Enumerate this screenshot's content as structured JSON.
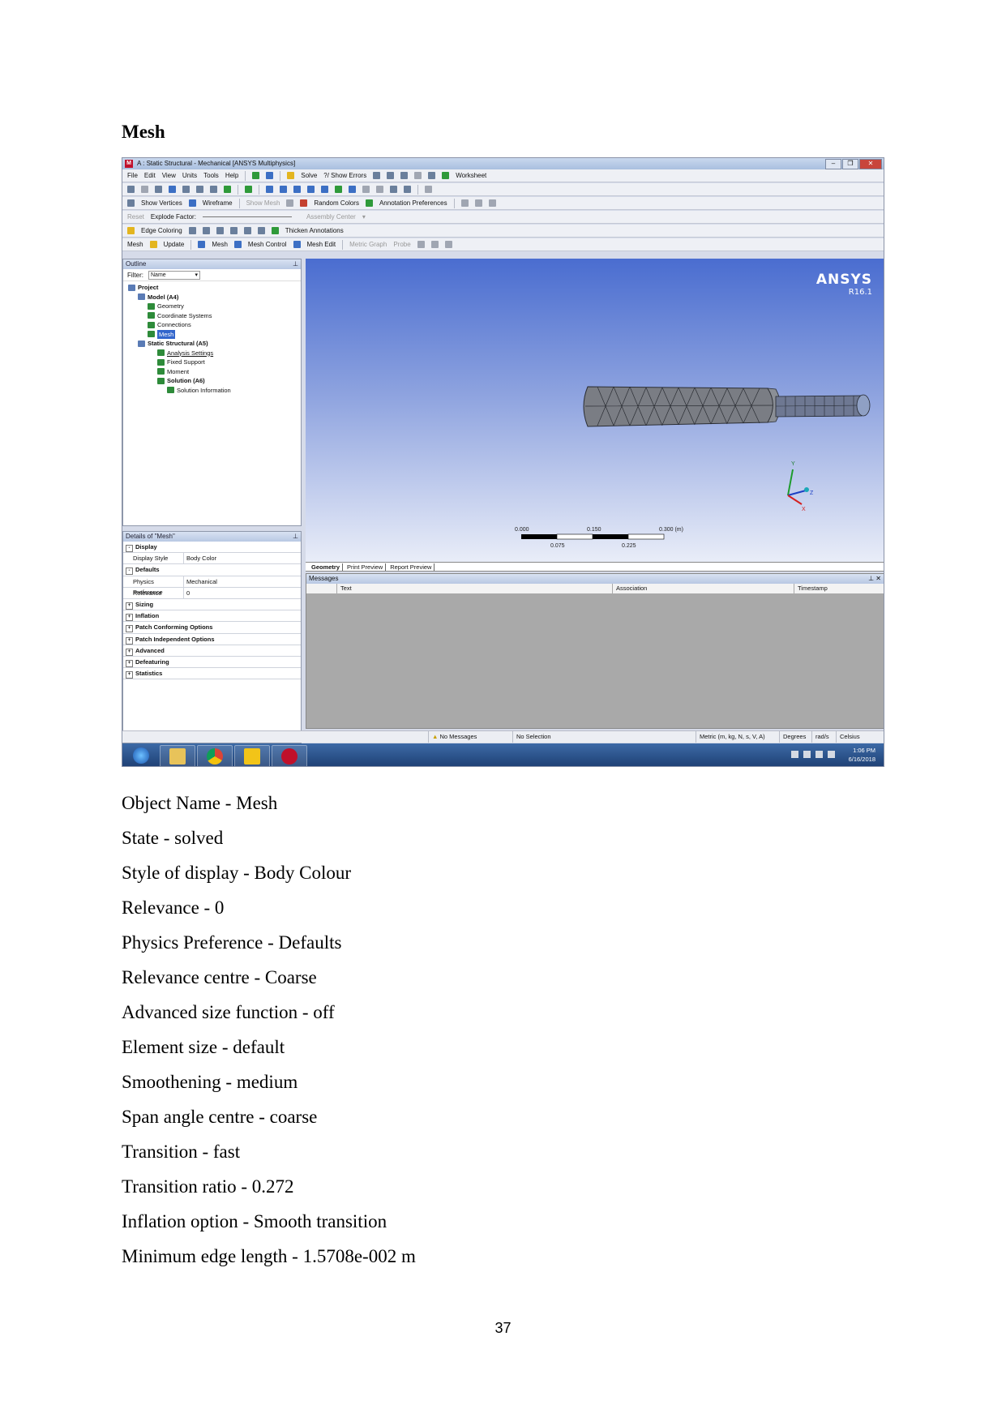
{
  "heading": "Mesh",
  "screenshot": {
    "window_title": "A : Static Structural - Mechanical [ANSYS Multiphysics]",
    "menu": [
      "File",
      "Edit",
      "View",
      "Units",
      "Tools",
      "Help"
    ],
    "toolbar1": {
      "solve": "Solve",
      "show_errors": "?/ Show Errors",
      "worksheet": "Worksheet"
    },
    "toolbar3": {
      "show_vertices": "Show Vertices",
      "wireframe": "Wireframe",
      "show_mesh": "Show Mesh",
      "random_colors": "Random Colors",
      "annotation_preferences": "Annotation Preferences"
    },
    "toolbar4": {
      "reset": "Reset",
      "explode_factor": "Explode Factor:",
      "assembly_center": "Assembly Center"
    },
    "toolbar5": {
      "edge_coloring": "Edge Coloring",
      "thicken_annotations": "Thicken Annotations"
    },
    "toolbar6": {
      "mesh": "Mesh",
      "update": "Update",
      "mesh_dd": "Mesh",
      "mesh_control": "Mesh Control",
      "mesh_edit": "Mesh Edit",
      "metric_graph": "Metric Graph",
      "probe": "Probe"
    },
    "outline": {
      "title": "Outline",
      "filter_label": "Filter:",
      "filter_value": "Name",
      "tree": [
        {
          "label": "Project",
          "indent": 0,
          "bold": true
        },
        {
          "label": "Model (A4)",
          "indent": 1,
          "bold": true
        },
        {
          "label": "Geometry",
          "indent": 2
        },
        {
          "label": "Coordinate Systems",
          "indent": 2
        },
        {
          "label": "Connections",
          "indent": 2
        },
        {
          "label": "Mesh",
          "indent": 2,
          "selected": true
        },
        {
          "label": "Static Structural (A5)",
          "indent": 1,
          "bold": true
        },
        {
          "label": "Analysis Settings",
          "indent": 3,
          "underline": true
        },
        {
          "label": "Fixed Support",
          "indent": 3
        },
        {
          "label": "Moment",
          "indent": 3
        },
        {
          "label": "Solution (A6)",
          "indent": 3,
          "bold": true
        },
        {
          "label": "Solution Information",
          "indent": 4
        }
      ]
    },
    "details": {
      "title": "Details of \"Mesh\"",
      "rows": [
        {
          "type": "group",
          "label": "Display",
          "sign": "-"
        },
        {
          "type": "row",
          "label": "Display Style",
          "value": "Body Color"
        },
        {
          "type": "group",
          "label": "Defaults",
          "sign": "-"
        },
        {
          "type": "row",
          "label": "Physics Preference",
          "value": "Mechanical"
        },
        {
          "type": "row",
          "label": "Relevance",
          "value": "0"
        },
        {
          "type": "group",
          "label": "Sizing",
          "sign": "+"
        },
        {
          "type": "group",
          "label": "Inflation",
          "sign": "+"
        },
        {
          "type": "group",
          "label": "Patch Conforming Options",
          "sign": "+"
        },
        {
          "type": "group",
          "label": "Patch Independent Options",
          "sign": "+"
        },
        {
          "type": "group",
          "label": "Advanced",
          "sign": "+"
        },
        {
          "type": "group",
          "label": "Defeaturing",
          "sign": "+"
        },
        {
          "type": "group",
          "label": "Statistics",
          "sign": "+"
        }
      ]
    },
    "brand": {
      "name": "ANSYS",
      "version": "R16.1"
    },
    "scale_bar": {
      "top_labels": [
        "0.000",
        "0.150",
        "0.300 (m)"
      ],
      "bottom_labels": [
        "0.075",
        "0.225"
      ]
    },
    "triad": {
      "y": "Y",
      "z": "Z",
      "x": "X"
    },
    "tabs": [
      "Geometry",
      "Print Preview",
      "Report Preview"
    ],
    "messages": {
      "title": "Messages",
      "columns": [
        "Text",
        "Association",
        "Timestamp"
      ]
    },
    "status": {
      "messages": "No Messages",
      "selection": "No Selection",
      "units": "Metric (m, kg, N, s, V, A)",
      "angle": "Degrees",
      "rate": "rad/s",
      "temp": "Celsius"
    },
    "taskbar": {
      "time": "1:06 PM",
      "date": "6/16/2018"
    }
  },
  "properties": [
    "Object Name - Mesh",
    "State - solved",
    "Style of display - Body Colour",
    "Relevance - 0",
    "Physics Preference - Defaults",
    "Relevance centre - Coarse",
    "Advanced size function - off",
    "Element size - default",
    "Smoothening - medium",
    "Span angle centre - coarse",
    "Transition - fast",
    "Transition ratio - 0.272",
    "Inflation option - Smooth transition",
    "Minimum edge length - 1.5708e-002 m"
  ],
  "page_number": "37"
}
